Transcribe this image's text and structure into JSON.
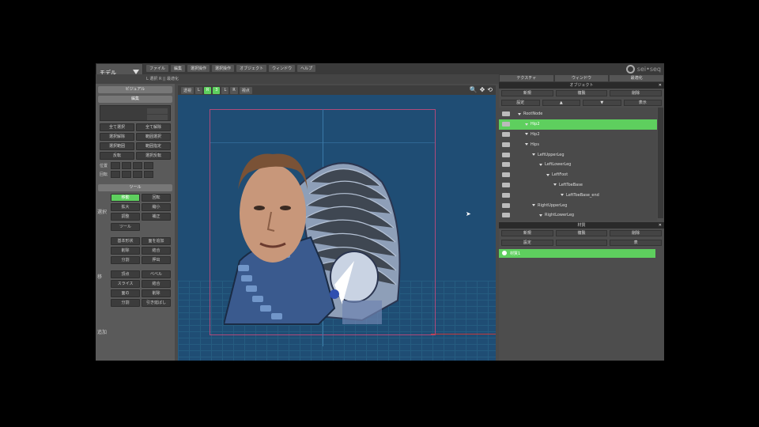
{
  "app": {
    "mode_label": "モデル",
    "menu": [
      "ファイル",
      "編集",
      "選択操作",
      "選択操作",
      "オブジェクト",
      "ウィンドウ",
      "ヘルプ"
    ],
    "logo_text": "sei•seq"
  },
  "subbar": {
    "label": "L 選択 R  ||  最適化"
  },
  "left_panel": {
    "section1_title": "ビジュアル",
    "section1_sub": "編集",
    "buttons_a": [
      "全て選択",
      "全て解除",
      "選択解除",
      "範囲選択",
      "選択範囲",
      "範囲指定",
      "反転",
      "選択反転"
    ],
    "xyz_labels": [
      "位置",
      "回転"
    ],
    "section2_title": "ツール",
    "buttons_b": [
      "移動",
      "回転",
      "拡大",
      "縮小",
      "調整",
      "補正"
    ],
    "button_wide": "ツール",
    "buttons_c": [
      "基本形状",
      "面を追加",
      "削除",
      "結合",
      "分割",
      "押出"
    ],
    "buttons_d": [
      "頂点",
      "ベベル",
      "スライス",
      "結合",
      "面の",
      "削除",
      "分割",
      "引き延ばし"
    ],
    "vertical_labels": [
      "選択",
      "移",
      "追加"
    ]
  },
  "viewport": {
    "toolbar": [
      "透視",
      "L",
      "R",
      "3",
      "L",
      "R",
      "視点"
    ],
    "active_indices": [
      2,
      3
    ],
    "icons": [
      "🔍",
      "✥",
      "⟲"
    ]
  },
  "right_panel": {
    "tabs": [
      "テクスチャ",
      "ウィンドウ",
      "最適化"
    ],
    "objects_title": "オブジェクト",
    "object_buttons": [
      "新規",
      "複製",
      "削除"
    ],
    "object_buttons2": [
      "設定",
      "▲",
      "▼",
      "表示"
    ],
    "tree": [
      {
        "label": "RootNode",
        "indent": 0
      },
      {
        "label": "Hip2",
        "indent": 1,
        "selected": true
      },
      {
        "label": "Hip2",
        "indent": 1
      },
      {
        "label": "Hips",
        "indent": 1
      },
      {
        "label": "LeftUpperLeg",
        "indent": 2
      },
      {
        "label": "LeftLowerLeg",
        "indent": 3
      },
      {
        "label": "LeftFoot",
        "indent": 4
      },
      {
        "label": "LeftToeBase",
        "indent": 5
      },
      {
        "label": "LeftToeBase_end",
        "indent": 6
      },
      {
        "label": "RightUpperLeg",
        "indent": 2
      },
      {
        "label": "RightLowerLeg",
        "indent": 3
      }
    ],
    "material_title": "材質",
    "material_buttons": [
      "新規",
      "複製",
      "削除"
    ],
    "material_buttons2": [
      "設定",
      "",
      "表"
    ],
    "material_selected": "材質1"
  }
}
